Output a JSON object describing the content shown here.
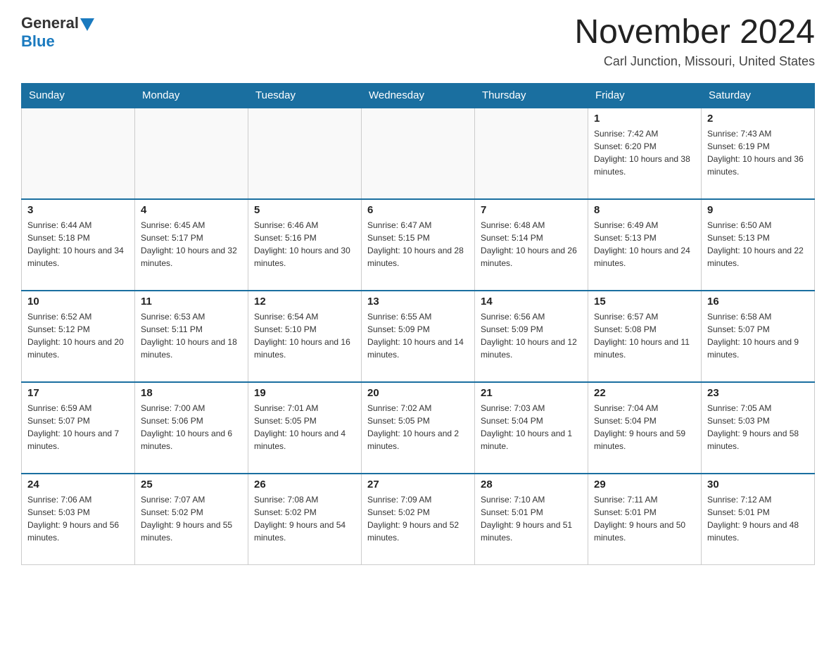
{
  "header": {
    "logo_general": "General",
    "logo_blue": "Blue",
    "month_title": "November 2024",
    "location": "Carl Junction, Missouri, United States"
  },
  "weekdays": [
    "Sunday",
    "Monday",
    "Tuesday",
    "Wednesday",
    "Thursday",
    "Friday",
    "Saturday"
  ],
  "weeks": [
    [
      {
        "day": "",
        "info": ""
      },
      {
        "day": "",
        "info": ""
      },
      {
        "day": "",
        "info": ""
      },
      {
        "day": "",
        "info": ""
      },
      {
        "day": "",
        "info": ""
      },
      {
        "day": "1",
        "info": "Sunrise: 7:42 AM\nSunset: 6:20 PM\nDaylight: 10 hours and 38 minutes."
      },
      {
        "day": "2",
        "info": "Sunrise: 7:43 AM\nSunset: 6:19 PM\nDaylight: 10 hours and 36 minutes."
      }
    ],
    [
      {
        "day": "3",
        "info": "Sunrise: 6:44 AM\nSunset: 5:18 PM\nDaylight: 10 hours and 34 minutes."
      },
      {
        "day": "4",
        "info": "Sunrise: 6:45 AM\nSunset: 5:17 PM\nDaylight: 10 hours and 32 minutes."
      },
      {
        "day": "5",
        "info": "Sunrise: 6:46 AM\nSunset: 5:16 PM\nDaylight: 10 hours and 30 minutes."
      },
      {
        "day": "6",
        "info": "Sunrise: 6:47 AM\nSunset: 5:15 PM\nDaylight: 10 hours and 28 minutes."
      },
      {
        "day": "7",
        "info": "Sunrise: 6:48 AM\nSunset: 5:14 PM\nDaylight: 10 hours and 26 minutes."
      },
      {
        "day": "8",
        "info": "Sunrise: 6:49 AM\nSunset: 5:13 PM\nDaylight: 10 hours and 24 minutes."
      },
      {
        "day": "9",
        "info": "Sunrise: 6:50 AM\nSunset: 5:13 PM\nDaylight: 10 hours and 22 minutes."
      }
    ],
    [
      {
        "day": "10",
        "info": "Sunrise: 6:52 AM\nSunset: 5:12 PM\nDaylight: 10 hours and 20 minutes."
      },
      {
        "day": "11",
        "info": "Sunrise: 6:53 AM\nSunset: 5:11 PM\nDaylight: 10 hours and 18 minutes."
      },
      {
        "day": "12",
        "info": "Sunrise: 6:54 AM\nSunset: 5:10 PM\nDaylight: 10 hours and 16 minutes."
      },
      {
        "day": "13",
        "info": "Sunrise: 6:55 AM\nSunset: 5:09 PM\nDaylight: 10 hours and 14 minutes."
      },
      {
        "day": "14",
        "info": "Sunrise: 6:56 AM\nSunset: 5:09 PM\nDaylight: 10 hours and 12 minutes."
      },
      {
        "day": "15",
        "info": "Sunrise: 6:57 AM\nSunset: 5:08 PM\nDaylight: 10 hours and 11 minutes."
      },
      {
        "day": "16",
        "info": "Sunrise: 6:58 AM\nSunset: 5:07 PM\nDaylight: 10 hours and 9 minutes."
      }
    ],
    [
      {
        "day": "17",
        "info": "Sunrise: 6:59 AM\nSunset: 5:07 PM\nDaylight: 10 hours and 7 minutes."
      },
      {
        "day": "18",
        "info": "Sunrise: 7:00 AM\nSunset: 5:06 PM\nDaylight: 10 hours and 6 minutes."
      },
      {
        "day": "19",
        "info": "Sunrise: 7:01 AM\nSunset: 5:05 PM\nDaylight: 10 hours and 4 minutes."
      },
      {
        "day": "20",
        "info": "Sunrise: 7:02 AM\nSunset: 5:05 PM\nDaylight: 10 hours and 2 minutes."
      },
      {
        "day": "21",
        "info": "Sunrise: 7:03 AM\nSunset: 5:04 PM\nDaylight: 10 hours and 1 minute."
      },
      {
        "day": "22",
        "info": "Sunrise: 7:04 AM\nSunset: 5:04 PM\nDaylight: 9 hours and 59 minutes."
      },
      {
        "day": "23",
        "info": "Sunrise: 7:05 AM\nSunset: 5:03 PM\nDaylight: 9 hours and 58 minutes."
      }
    ],
    [
      {
        "day": "24",
        "info": "Sunrise: 7:06 AM\nSunset: 5:03 PM\nDaylight: 9 hours and 56 minutes."
      },
      {
        "day": "25",
        "info": "Sunrise: 7:07 AM\nSunset: 5:02 PM\nDaylight: 9 hours and 55 minutes."
      },
      {
        "day": "26",
        "info": "Sunrise: 7:08 AM\nSunset: 5:02 PM\nDaylight: 9 hours and 54 minutes."
      },
      {
        "day": "27",
        "info": "Sunrise: 7:09 AM\nSunset: 5:02 PM\nDaylight: 9 hours and 52 minutes."
      },
      {
        "day": "28",
        "info": "Sunrise: 7:10 AM\nSunset: 5:01 PM\nDaylight: 9 hours and 51 minutes."
      },
      {
        "day": "29",
        "info": "Sunrise: 7:11 AM\nSunset: 5:01 PM\nDaylight: 9 hours and 50 minutes."
      },
      {
        "day": "30",
        "info": "Sunrise: 7:12 AM\nSunset: 5:01 PM\nDaylight: 9 hours and 48 minutes."
      }
    ]
  ]
}
